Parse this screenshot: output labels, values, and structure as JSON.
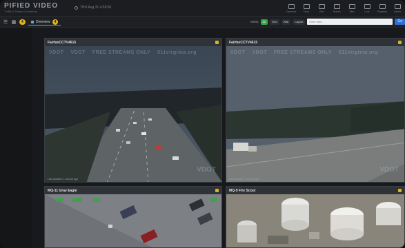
{
  "header": {
    "logo_text": "PIFIED VIDEO",
    "logo_subtitle": "Traffic & Safety Operations",
    "system_time": "THU Aug 31 4:58:56",
    "tray": [
      {
        "label": "Cameras",
        "icon": "camera-icon"
      },
      {
        "label": "Tours",
        "icon": "tours-icon"
      },
      {
        "label": "Grid",
        "icon": "grid-icon"
      },
      {
        "label": "Search",
        "icon": "search-icon"
      },
      {
        "label": "Alert",
        "icon": "bell-icon"
      },
      {
        "label": "Lock",
        "icon": "lock-icon"
      },
      {
        "label": "Playback",
        "icon": "playback-icon"
      },
      {
        "label": "Admin",
        "icon": "gear-icon"
      }
    ]
  },
  "toolbar": {
    "count_badge": "4",
    "tab_label": "Overview",
    "tab_badge": "4",
    "views_label": "Views",
    "view_buttons": [
      "All",
      "Grid",
      "Wall",
      "Layout"
    ],
    "search_placeholder": "Enter filter...",
    "go_label": "Go"
  },
  "panels": [
    {
      "title": "FairfaxCCTV4615",
      "watermark": [
        "VDOT",
        "VDOT",
        "FREE STREAMS ONLY",
        "511virginia.org"
      ],
      "brand": "VDOT",
      "footer": "Last Updated: 1 second ago"
    },
    {
      "title": "FairfaxCCTV4615",
      "watermark": [
        "VDOT",
        "VDOT",
        "FREE STREAMS ONLY",
        "511virginia.org"
      ],
      "brand": "VDOT",
      "footer": "Last Updated: 1 second ago"
    },
    {
      "title": "MQ-11 Gray Eagle",
      "watermark": [],
      "brand": "",
      "footer": ""
    },
    {
      "title": "MQ-9 Fire Scout",
      "watermark": [],
      "brand": "",
      "footer": ""
    }
  ],
  "colors": {
    "accent_yellow": "#e0b21a",
    "accent_green": "#3aa34b",
    "accent_blue": "#2d6fd6",
    "app_bg": "#17191c"
  }
}
